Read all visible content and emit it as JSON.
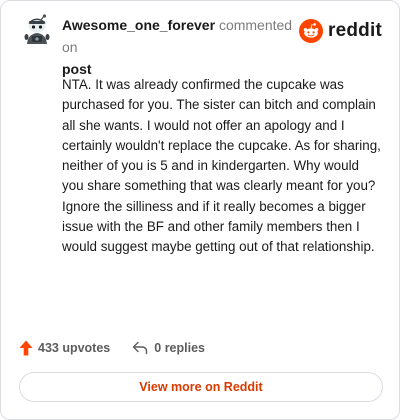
{
  "header": {
    "username": "Awesome_one_forever",
    "action_text": "commented on",
    "post_link": "post"
  },
  "brand": {
    "name": "reddit",
    "color": "#ff4500"
  },
  "comment": {
    "text": "NTA. It was already confirmed the cupcake was purchased for you. The sister can bitch and complain all she wants. I would not offer an apology and I certainly wouldn't replace the cupcake. As for sharing, neither of you is 5 and in kindergarten. Why would you share something that was clearly meant for you? Ignore the silliness and if it really becomes a bigger issue with the BF and other family members then I would suggest maybe getting out of that relationship."
  },
  "footer": {
    "upvotes_label": "433 upvotes",
    "replies_label": "0 replies",
    "upvote_icon": "upvote-arrow-icon",
    "reply_icon": "reply-arrow-icon"
  },
  "view_more_label": "View more on Reddit",
  "colors": {
    "accent": "#d93a00",
    "upvote": "#ff4500",
    "text": "#1a1a1b",
    "muted": "#7c7c7c",
    "border": "#d9dde2"
  }
}
